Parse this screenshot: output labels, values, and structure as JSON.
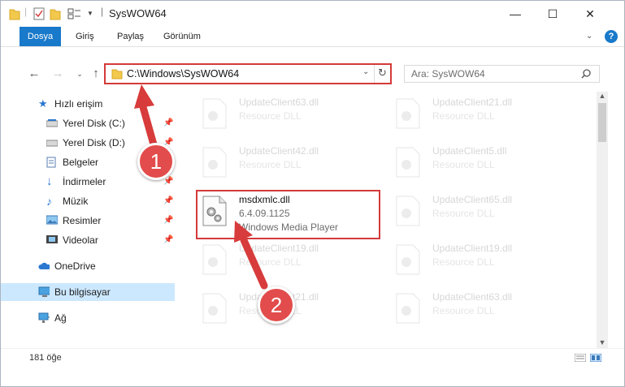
{
  "window": {
    "title": "SysWOW64"
  },
  "ribbon": {
    "tabs": [
      "Dosya",
      "Giriş",
      "Paylaş",
      "Görünüm"
    ]
  },
  "address": {
    "path": "C:\\Windows\\SysWOW64"
  },
  "search": {
    "placeholder": "Ara: SysWOW64"
  },
  "nav": {
    "items": [
      {
        "label": "Hızlı erişim",
        "icon": "star-icon"
      },
      {
        "label": "Yerel Disk (C:)",
        "icon": "drive-icon",
        "pinned": true
      },
      {
        "label": "Yerel Disk (D:)",
        "icon": "drive-icon",
        "pinned": true
      },
      {
        "label": "Belgeler",
        "icon": "documents-icon",
        "pinned": true
      },
      {
        "label": "İndirmeler",
        "icon": "downloads-icon",
        "pinned": true
      },
      {
        "label": "Müzik",
        "icon": "music-icon",
        "pinned": true
      },
      {
        "label": "Resimler",
        "icon": "pictures-icon",
        "pinned": true
      },
      {
        "label": "Videolar",
        "icon": "videos-icon",
        "pinned": true
      },
      {
        "label": "OneDrive",
        "icon": "onedrive-icon"
      },
      {
        "label": "Bu bilgisayar",
        "icon": "this-pc-icon",
        "selected": true
      },
      {
        "label": "Ağ",
        "icon": "network-icon"
      }
    ]
  },
  "files": {
    "left": [
      {
        "name": "UpdateClient63.dll",
        "sub": "Resource DLL"
      },
      {
        "name": "UpdateClient42.dll",
        "sub": "Resource DLL"
      },
      {
        "name": "msdxmlc.dll",
        "sub": "6.4.09.1125",
        "sub2": "Windows Media Player"
      },
      {
        "name": "UpdateClient19.dll",
        "sub": "Resource DLL"
      },
      {
        "name": "UpdateClient21.dll",
        "sub": "Resource DLL"
      }
    ],
    "right": [
      {
        "name": "UpdateClient21.dll",
        "sub": "Resource DLL"
      },
      {
        "name": "UpdateClient5.dll",
        "sub": "Resource DLL"
      },
      {
        "name": "UpdateClient65.dll",
        "sub": "Resource DLL"
      },
      {
        "name": "UpdateClient19.dll",
        "sub": "Resource DLL"
      },
      {
        "name": "UpdateClient63.dll",
        "sub": "Resource DLL"
      }
    ]
  },
  "status": {
    "count": "181 öğe"
  },
  "annotations": {
    "step1": "1",
    "step2": "2"
  },
  "colors": {
    "accent": "#1979ca",
    "highlight": "#d43a3a",
    "selection": "#cce8ff"
  }
}
